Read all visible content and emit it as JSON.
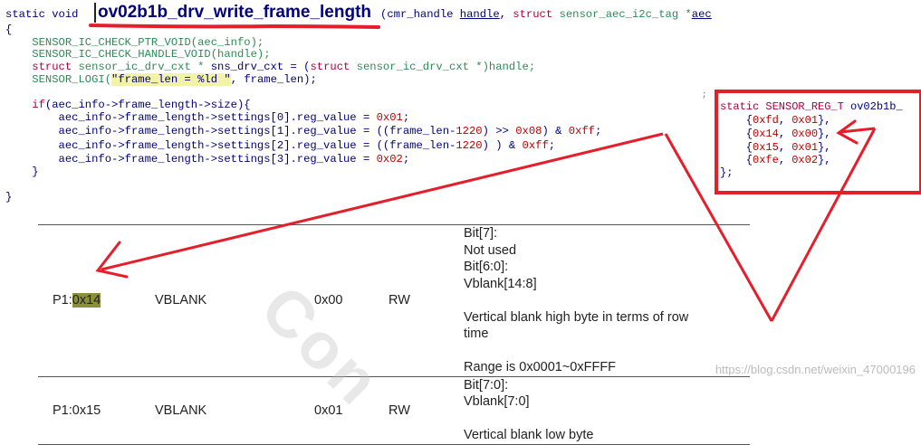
{
  "code": {
    "line0_prefix": "static void",
    "function_name": "ov02b1b_drv_write_frame_length",
    "line0_suffix_a": "(cmr_handle ",
    "line0_handle": "handle",
    "line0_suffix_b": ", ",
    "line0_struct": "struct",
    "line0_suffix_c": " sensor_aec_i2c_tag *",
    "line0_aec": "aec",
    "line1": "{",
    "line2": "    SENSOR_IC_CHECK_PTR_VOID(aec_info);",
    "line3": "    SENSOR_IC_CHECK_HANDLE_VOID(handle);",
    "line4_struct": "    struct",
    "line4_rest": " sensor_ic_drv_cxt * ",
    "line4_var": "sns_drv_cxt",
    "line4_eq": " = (",
    "line4_struct2": "struct",
    "line4_tail": " sensor_ic_drv_cxt *)handle;",
    "line5_a": "    SENSOR_LOGI(",
    "line5_str": "\"frame_len = %ld \"",
    "line5_b": ", frame_len);",
    "line7_if": "    if",
    "line7_rest": "(aec_info->frame_length->size){",
    "line8_a": "        aec_info->frame_length->settings[0].reg_value = ",
    "line8_num": "0x01",
    "line8_b": ";",
    "line9_a": "        aec_info->frame_length->settings[1].reg_value = ((frame_len-",
    "line9_n1": "1220",
    "line9_b": ") >> ",
    "line9_n2": "0x08",
    "line9_c": ") & ",
    "line9_n3": "0xff",
    "line9_d": ";",
    "line10_a": "        aec_info->frame_length->settings[2].reg_value = ((frame_len-",
    "line10_n1": "1220",
    "line10_b": ") ) & ",
    "line10_n2": "0xff",
    "line10_c": ";",
    "line11_a": "        aec_info->frame_length->settings[3].reg_value = ",
    "line11_num": "0x02",
    "line11_b": ";",
    "line12": "    }",
    "line14": "}"
  },
  "reg_table_snippet": {
    "header_a": "static SENSOR_REG_T ",
    "header_b": "ov02b1b_",
    "r1_a": "    {",
    "r1_n1": "0xfd",
    "r1_m": ", ",
    "r1_n2": "0x01",
    "r1_b": "},",
    "r2_a": "    {",
    "r2_n1": "0x14",
    "r2_m": ", ",
    "r2_n2": "0x00",
    "r2_b": "},",
    "r3_a": "    {",
    "r3_n1": "0x15",
    "r3_m": ", ",
    "r3_n2": "0x01",
    "r3_b": "},",
    "r4_a": "    {",
    "r4_n1": "0xfe",
    "r4_m": ", ",
    "r4_n2": "0x02",
    "r4_b": "},",
    "close": "};"
  },
  "datasheet": {
    "rows": [
      {
        "addr_prefix": "P1:",
        "addr_hl": "0x14",
        "name": "VBLANK",
        "default": "0x00",
        "rw": "RW",
        "bits": [
          {
            "bit": "Bit[7]:",
            "text": "Not used"
          },
          {
            "bit": "Bit[6:0]:",
            "text": "Vblank[14:8]"
          },
          {
            "bit": "",
            "text": "Vertical blank high byte in terms of row time"
          },
          {
            "bit": "",
            "text": "Range is 0x0001~0xFFFF"
          }
        ]
      },
      {
        "addr": "P1:0x15",
        "name": "VBLANK",
        "default": "0x01",
        "rw": "RW",
        "bits": [
          {
            "bit": "Bit[7:0]:",
            "text": "Vblank[7:0]"
          },
          {
            "bit": "",
            "text": "Vertical blank low byte"
          }
        ]
      }
    ]
  },
  "watermark_text": "Con",
  "csdn_text": "https://blog.csdn.net/weixin_47000196",
  "colors": {
    "annotation_red": "#e41e2b",
    "keyword": "#b00040",
    "type": "#2e8b57",
    "text": "#000080"
  }
}
